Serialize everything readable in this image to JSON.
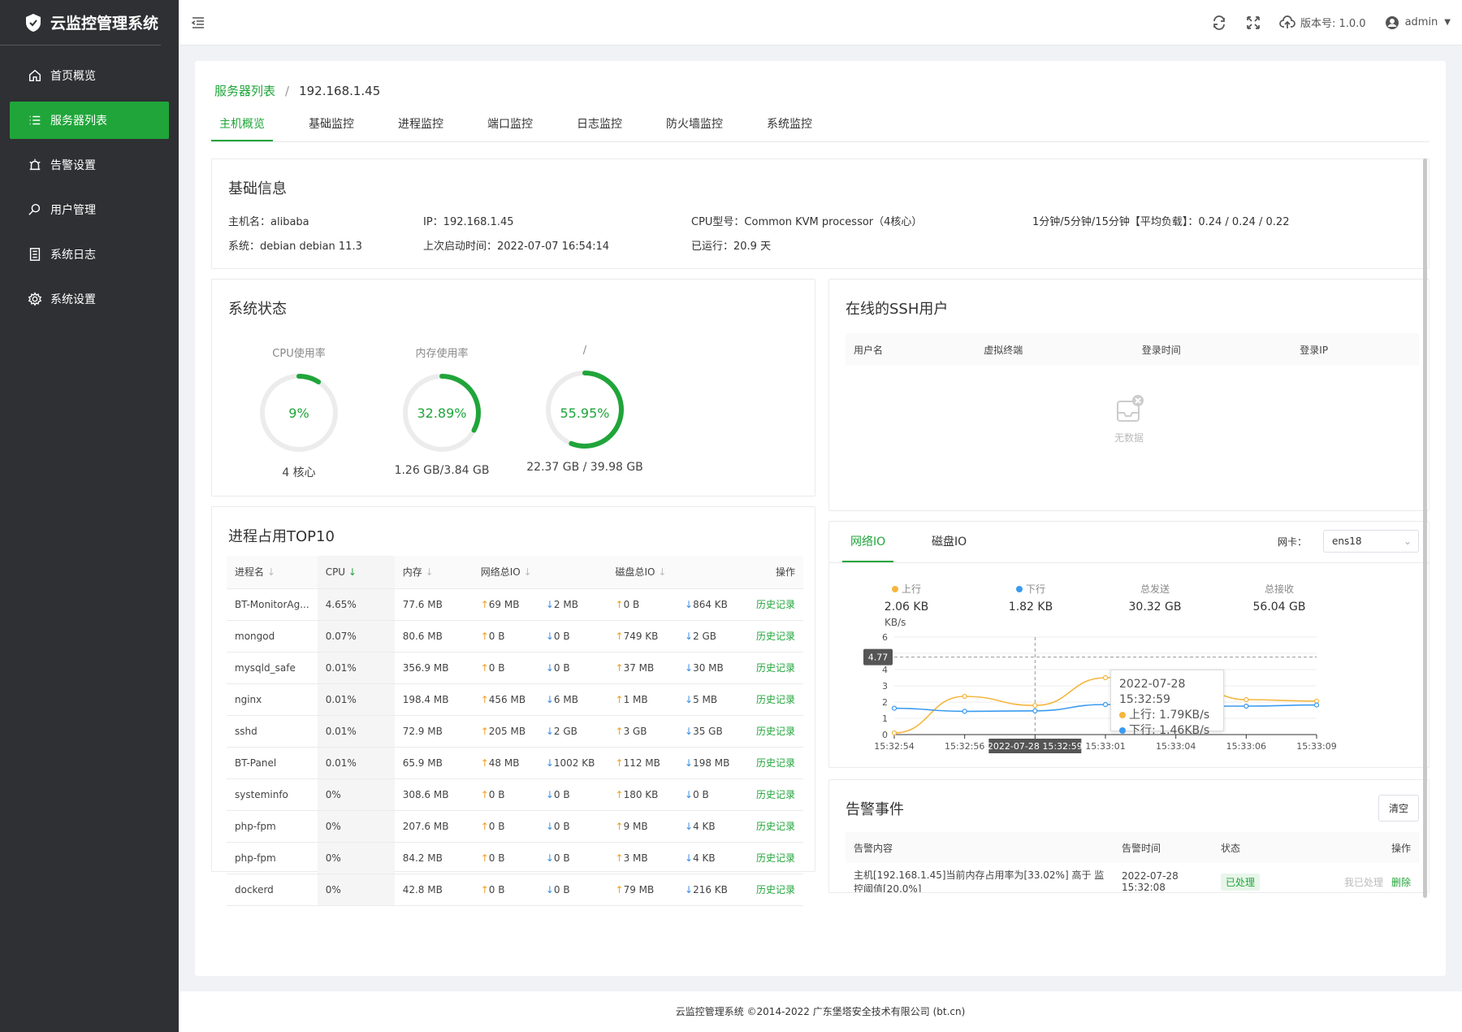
{
  "app": {
    "title": "云监控管理系统"
  },
  "sidebar": {
    "items": [
      {
        "label": "首页概览",
        "icon": "home-icon"
      },
      {
        "label": "服务器列表",
        "icon": "list-icon"
      },
      {
        "label": "告警设置",
        "icon": "alarm-icon"
      },
      {
        "label": "用户管理",
        "icon": "search-user-icon"
      },
      {
        "label": "系统日志",
        "icon": "log-icon"
      },
      {
        "label": "系统设置",
        "icon": "gear-icon"
      }
    ]
  },
  "topbar": {
    "version": "版本号: 1.0.0",
    "user": "admin"
  },
  "breadcrumb": {
    "parent": "服务器列表",
    "current": "192.168.1.45"
  },
  "tabs": [
    "主机概览",
    "基础监控",
    "进程监控",
    "端口监控",
    "日志监控",
    "防火墙监控",
    "系统监控"
  ],
  "basic": {
    "title": "基础信息",
    "hostname": "主机名：alibaba",
    "system": "系统：debian debian 11.3",
    "ip": "IP：192.168.1.45",
    "boot": "上次启动时间：2022-07-07 16:54:14",
    "cpu": "CPU型号：Common KVM processor（4核心）",
    "uptime": "已运行：20.9 天",
    "load": "1分钟/5分钟/15分钟【平均负载】：0.24 / 0.24 / 0.22"
  },
  "status": {
    "title": "系统状态",
    "gauges": [
      {
        "label": "CPU使用率",
        "value": "9%",
        "percent": 9,
        "sub": "4 核心"
      },
      {
        "label": "内存使用率",
        "value": "32.89%",
        "percent": 32.89,
        "sub": "1.26 GB/3.84 GB"
      },
      {
        "label": "/",
        "value": "55.95%",
        "percent": 55.95,
        "sub": "22.37 GB / 39.98 GB"
      }
    ]
  },
  "ssh": {
    "title": "在线的SSH用户",
    "cols": [
      "用户名",
      "虚拟终端",
      "登录时间",
      "登录IP"
    ],
    "empty": "无数据"
  },
  "top10": {
    "title": "进程占用TOP10",
    "cols": {
      "name": "进程名",
      "cpu": "CPU",
      "mem": "内存",
      "net": "网络总IO",
      "disk": "磁盘总IO",
      "op": "操作"
    },
    "history": "历史记录",
    "rows": [
      {
        "name": "BT-MonitorAg...",
        "cpu": "4.65%",
        "mem": "77.6 MB",
        "nup": "69 MB",
        "ndn": "2 MB",
        "dup": "0 B",
        "ddn": "864 KB"
      },
      {
        "name": "mongod",
        "cpu": "0.07%",
        "mem": "80.6 MB",
        "nup": "0 B",
        "ndn": "0 B",
        "dup": "749 KB",
        "ddn": "2 GB"
      },
      {
        "name": "mysqld_safe",
        "cpu": "0.01%",
        "mem": "356.9 MB",
        "nup": "0 B",
        "ndn": "0 B",
        "dup": "37 MB",
        "ddn": "30 MB"
      },
      {
        "name": "nginx",
        "cpu": "0.01%",
        "mem": "198.4 MB",
        "nup": "456 MB",
        "ndn": "6 MB",
        "dup": "1 MB",
        "ddn": "5 MB"
      },
      {
        "name": "sshd",
        "cpu": "0.01%",
        "mem": "72.9 MB",
        "nup": "205 MB",
        "ndn": "2 GB",
        "dup": "3 GB",
        "ddn": "35 GB"
      },
      {
        "name": "BT-Panel",
        "cpu": "0.01%",
        "mem": "65.9 MB",
        "nup": "48 MB",
        "ndn": "1002 KB",
        "dup": "112 MB",
        "ddn": "198 MB"
      },
      {
        "name": "systeminfo",
        "cpu": "0%",
        "mem": "308.6 MB",
        "nup": "0 B",
        "ndn": "0 B",
        "dup": "180 KB",
        "ddn": "0 B"
      },
      {
        "name": "php-fpm",
        "cpu": "0%",
        "mem": "207.6 MB",
        "nup": "0 B",
        "ndn": "0 B",
        "dup": "9 MB",
        "ddn": "4 KB"
      },
      {
        "name": "php-fpm",
        "cpu": "0%",
        "mem": "84.2 MB",
        "nup": "0 B",
        "ndn": "0 B",
        "dup": "3 MB",
        "ddn": "4 KB"
      },
      {
        "name": "dockerd",
        "cpu": "0%",
        "mem": "42.8 MB",
        "nup": "0 B",
        "ndn": "0 B",
        "dup": "79 MB",
        "ddn": "216 KB"
      }
    ]
  },
  "netio": {
    "tabs": [
      "网络IO",
      "磁盘IO"
    ],
    "nic_label": "网卡：",
    "nic": "ens18",
    "stats": [
      {
        "label": "上行",
        "value": "2.06 KB",
        "color": "#f5b63e"
      },
      {
        "label": "下行",
        "value": "1.82 KB",
        "color": "#3a9bf0"
      },
      {
        "label": "总发送",
        "value": "30.32 GB"
      },
      {
        "label": "总接收",
        "value": "56.04 GB"
      }
    ],
    "tooltip": {
      "time": "2022-07-28 15:32:59",
      "up": "上行: 1.79KB/s",
      "down": "下行: 1.46KB/s"
    },
    "crosshair_label": "2022-07-28 15:32:59",
    "marker": "4.77"
  },
  "chart_data": {
    "type": "line",
    "ylabel": "KB/s",
    "ylim": [
      0,
      6
    ],
    "yticks": [
      "0",
      "1",
      "2",
      "3",
      "4",
      "5",
      "6"
    ],
    "x": [
      "15:32:54",
      "15:32:56",
      "15:32:59",
      "15:33:01",
      "15:33:04",
      "15:33:06",
      "15:33:09"
    ],
    "series": [
      {
        "name": "上行",
        "color": "#f5b63e",
        "values": [
          0.1,
          2.35,
          1.79,
          3.5,
          3.55,
          2.15,
          2.06
        ]
      },
      {
        "name": "下行",
        "color": "#3a9bf0",
        "values": [
          1.62,
          1.43,
          1.46,
          1.85,
          1.75,
          1.75,
          1.82
        ]
      }
    ],
    "markline": 4.77
  },
  "alerts": {
    "title": "告警事件",
    "clear": "清空",
    "cols": [
      "告警内容",
      "告警时间",
      "状态",
      "操作"
    ],
    "rows": [
      {
        "content": "主机[192.168.1.45]当前内存占用率为[33.02%] 高于 监控阈值[20.0%]",
        "time": "2022-07-28 15:32:08",
        "status": "已处理",
        "handled": "我已处理",
        "delete": "删除"
      }
    ]
  },
  "footer": "云监控管理系统 ©2014-2022 广东堡塔安全技术有限公司 (bt.cn)"
}
